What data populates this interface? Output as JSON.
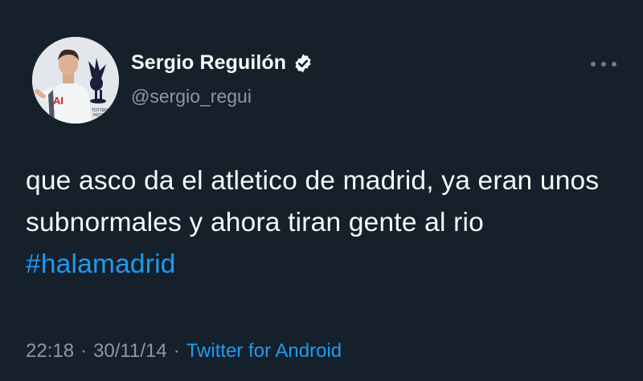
{
  "tweet": {
    "author": {
      "display_name": "Sergio Reguilón",
      "handle": "@sergio_regui",
      "verified": true,
      "verified_icon": "verified-badge-icon",
      "avatar_icon": "profile-photo-avatar"
    },
    "more_icon": "more-options-icon",
    "text_parts": {
      "line": "que asco da el atletico de madrid, ya eran unos subnormales y ahora tiran gente al rio",
      "hashtag": "#halamadrid"
    },
    "time": "22:18",
    "separator": "·",
    "date": "30/11/14",
    "source": "Twitter for Android"
  },
  "colors": {
    "background": "#15202b",
    "primary_text": "#f7f9f9",
    "secondary_text": "#8b98a5",
    "accent": "#1d9bf0"
  }
}
